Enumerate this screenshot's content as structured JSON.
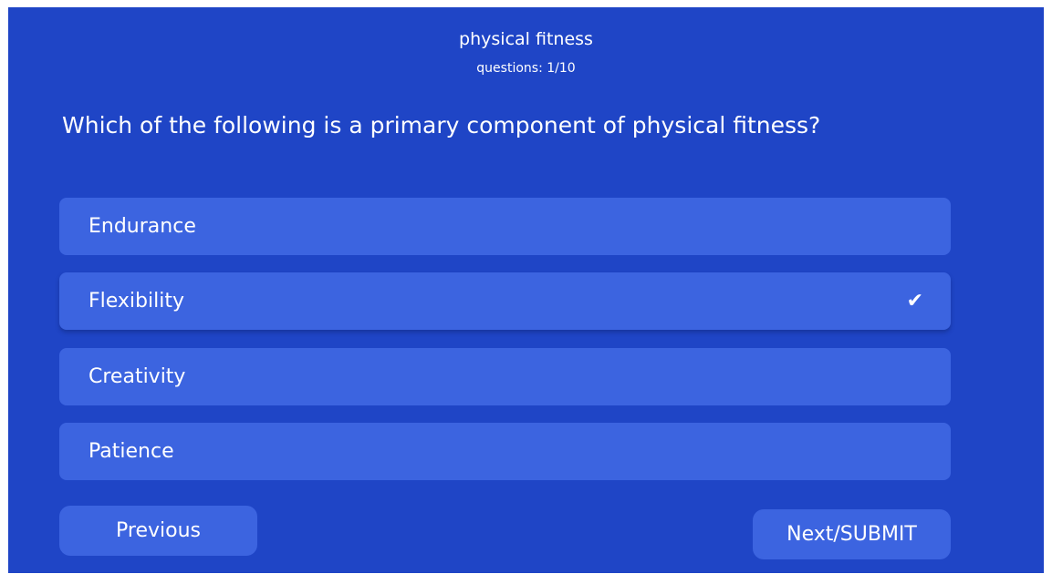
{
  "quiz": {
    "title": "physical fitness",
    "progress": "questions: 1/10",
    "question": "Which of the following is a primary component of physical fitness?"
  },
  "options": [
    {
      "label": "Endurance",
      "selected": false
    },
    {
      "label": "Flexibility",
      "selected": true
    },
    {
      "label": "Creativity",
      "selected": false
    },
    {
      "label": "Patience",
      "selected": false
    }
  ],
  "icons": {
    "check": "check-icon"
  },
  "navigation": {
    "previous_label": "Previous",
    "next_label": "Next/SUBMIT"
  },
  "colors": {
    "background": "#1f45c6",
    "option_background": "#3c64e0",
    "text": "#ffffff"
  }
}
